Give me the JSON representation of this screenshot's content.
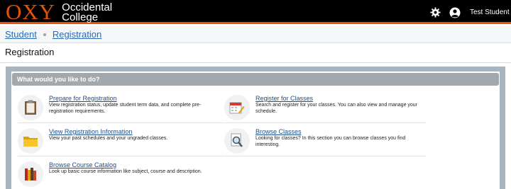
{
  "header": {
    "logo_mark": "OXY",
    "logo_line1": "Occidental",
    "logo_line2": "College",
    "user_name": "Test Student"
  },
  "breadcrumb": [
    "Student",
    "Registration"
  ],
  "page_title": "Registration",
  "panel_title": "What would you like to do?",
  "items": [
    {
      "label": "Prepare for Registration",
      "desc": "View registration status, update student term data, and complete pre-registration requirements.",
      "icon": "clipboard-icon"
    },
    {
      "label": "Register for Classes",
      "desc": "Search and register for your classes. You can also view and manage your schedule.",
      "icon": "calendar-pencil-icon"
    },
    {
      "label": "View Registration Information",
      "desc": "View your past schedules and your ungraded classes.",
      "icon": "folder-icon"
    },
    {
      "label": "Browse Classes",
      "desc": "Looking for classes? In this section you can browse classes you find interesting.",
      "icon": "magnifier-icon"
    },
    {
      "label": "Browse Course Catalog",
      "desc": "Look up basic course information like subject, course and description.",
      "icon": "books-icon"
    }
  ],
  "colors": {
    "brand_orange": "#e35205",
    "link_blue": "#1d4e89",
    "header_black": "#000000",
    "panel_gray": "#a3a8ad"
  }
}
